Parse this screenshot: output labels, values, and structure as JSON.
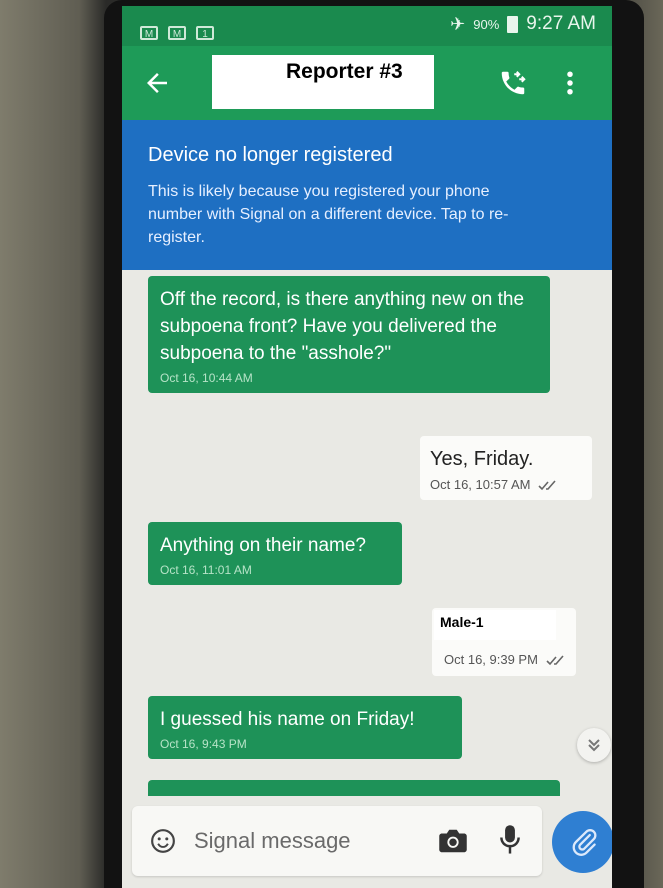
{
  "status_bar": {
    "battery_percent": "90%",
    "time": "9:27 AM",
    "notification_icons": [
      "gmail-icon",
      "gmail-icon",
      "calendar-icon"
    ],
    "calendar_glyph": "1"
  },
  "toolbar": {
    "title": "Reporter #3",
    "icons": {
      "back": "arrow-left-icon",
      "call": "phone-icon",
      "more": "more-vertical-icon"
    }
  },
  "banner": {
    "title": "Device no longer registered",
    "body": "This is likely because you registered your phone number with Signal on a different device. Tap to re-register."
  },
  "messages": [
    {
      "direction": "incoming",
      "text": "Off the record, is there anything new on the subpoena front? Have you delivered the subpoena to the \"asshole?\"",
      "timestamp": "Oct 16, 10:44 AM"
    },
    {
      "direction": "outgoing",
      "text": "Yes, Friday.",
      "timestamp": "Oct 16, 10:57 AM"
    },
    {
      "direction": "incoming",
      "text": "Anything on their name?",
      "timestamp": "Oct 16, 11:01 AM"
    },
    {
      "direction": "outgoing",
      "text": "Male-1",
      "timestamp": "Oct 16, 9:39 PM"
    },
    {
      "direction": "incoming",
      "text": "I guessed his name on Friday!",
      "timestamp": "Oct 16, 9:43 PM"
    }
  ],
  "compose": {
    "placeholder": "Signal message",
    "icons": {
      "emoji": "emoji-icon",
      "camera": "camera-icon",
      "mic": "microphone-icon",
      "attach": "paperclip-icon",
      "scroll_down": "double-chevron-down-icon"
    }
  },
  "colors": {
    "signal_green": "#1e9b58",
    "incoming_bubble": "#1e9258",
    "banner_blue": "#1e6fc2",
    "attach_blue": "#2f7fd2"
  }
}
